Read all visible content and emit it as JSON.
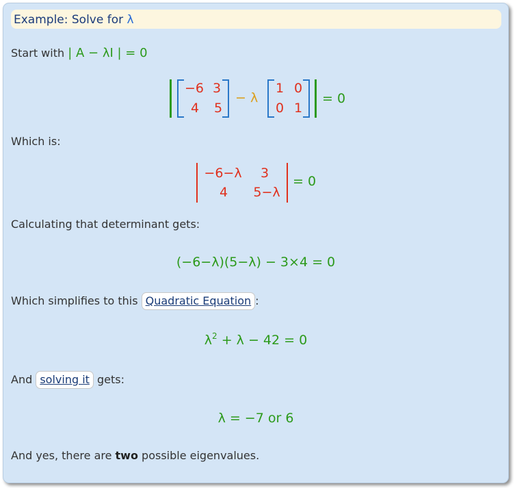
{
  "title": {
    "prefix": "Example: Solve for ",
    "lambda": "λ"
  },
  "p1": {
    "text": "Start with ",
    "expr": "| A − λI | = 0"
  },
  "matrixEq": {
    "A": [
      "−6",
      "3",
      "4",
      "5"
    ],
    "minus_lambda": "− λ",
    "I": [
      "1",
      "0",
      "0",
      "1"
    ],
    "rhs": "= 0"
  },
  "p2": "Which is:",
  "det": {
    "cells": [
      "−6−λ",
      "3",
      "4",
      "5−λ"
    ],
    "rhs": "= 0"
  },
  "p3": "Calculating that determinant gets:",
  "eq3": "(−6−λ)(5−λ) − 3×4 = 0",
  "p4": {
    "text": "Which simplifies to this ",
    "link": "Quadratic Equation",
    "after": ":"
  },
  "eq4": {
    "base": "λ",
    "exp": "2",
    "rest": " + λ − 42 = 0"
  },
  "p5": {
    "text": "And ",
    "link": "solving it",
    "after": " gets:"
  },
  "eq5": "λ = −7 or 6",
  "p6": {
    "before": "And yes, there are ",
    "bold": "two",
    "after": " possible eigenvalues."
  }
}
